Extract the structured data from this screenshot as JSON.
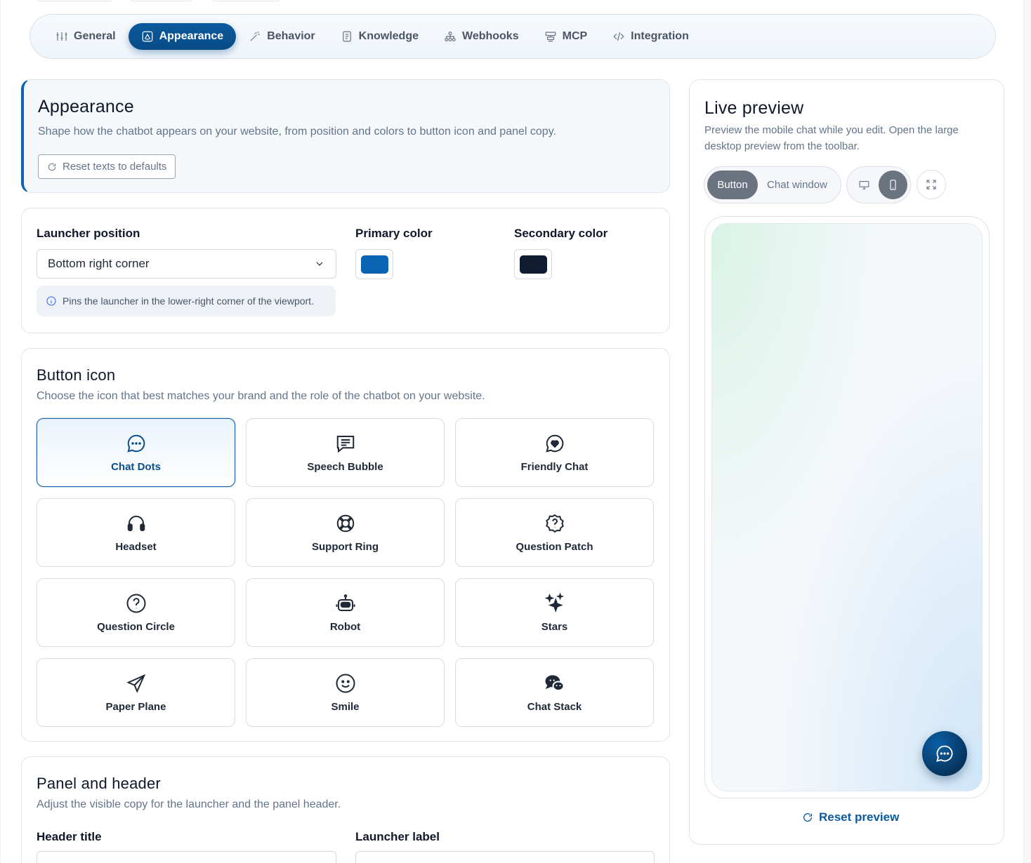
{
  "tabs": [
    {
      "label": "General",
      "icon": "sliders-icon",
      "active": false
    },
    {
      "label": "Appearance",
      "icon": "palette-icon",
      "active": true
    },
    {
      "label": "Behavior",
      "icon": "magic-wand-icon",
      "active": false
    },
    {
      "label": "Knowledge",
      "icon": "document-icon",
      "active": false
    },
    {
      "label": "Webhooks",
      "icon": "network-icon",
      "active": false
    },
    {
      "label": "MCP",
      "icon": "server-icon",
      "active": false
    },
    {
      "label": "Integration",
      "icon": "code-icon",
      "active": false
    }
  ],
  "appearance": {
    "title": "Appearance",
    "subtitle": "Shape how the chatbot appears on your website, from position and colors to button icon and panel copy.",
    "reset_label": "Reset texts to defaults"
  },
  "launcher": {
    "position_label": "Launcher position",
    "position_value": "Bottom right corner",
    "position_hint": "Pins the launcher in the lower-right corner of the viewport.",
    "primary_label": "Primary color",
    "primary_color": "#0b64b3",
    "secondary_label": "Secondary color",
    "secondary_color": "#0f1b2e"
  },
  "button_icon": {
    "title": "Button icon",
    "subtitle": "Choose the icon that best matches your brand and the role of the chatbot on your website.",
    "options": [
      {
        "label": "Chat Dots",
        "icon": "chat-dots-icon",
        "selected": true
      },
      {
        "label": "Speech Bubble",
        "icon": "speech-bubble-icon",
        "selected": false
      },
      {
        "label": "Friendly Chat",
        "icon": "friendly-chat-icon",
        "selected": false
      },
      {
        "label": "Headset",
        "icon": "headset-icon",
        "selected": false
      },
      {
        "label": "Support Ring",
        "icon": "support-ring-icon",
        "selected": false
      },
      {
        "label": "Question Patch",
        "icon": "question-patch-icon",
        "selected": false
      },
      {
        "label": "Question Circle",
        "icon": "question-circle-icon",
        "selected": false
      },
      {
        "label": "Robot",
        "icon": "robot-icon",
        "selected": false
      },
      {
        "label": "Stars",
        "icon": "stars-icon",
        "selected": false
      },
      {
        "label": "Paper Plane",
        "icon": "paper-plane-icon",
        "selected": false
      },
      {
        "label": "Smile",
        "icon": "smile-icon",
        "selected": false
      },
      {
        "label": "Chat Stack",
        "icon": "chat-stack-icon",
        "selected": false
      }
    ]
  },
  "panel": {
    "title": "Panel and header",
    "subtitle": "Adjust the visible copy for the launcher and the panel header.",
    "header_title_label": "Header title",
    "launcher_label_label": "Launcher label"
  },
  "preview": {
    "title": "Live preview",
    "subtitle": "Preview the mobile chat while you edit. Open the large desktop preview from the toolbar.",
    "mode_button": "Button",
    "mode_chat": "Chat window",
    "active_mode": "Button",
    "active_device": "mobile",
    "reset_label": "Reset preview"
  }
}
